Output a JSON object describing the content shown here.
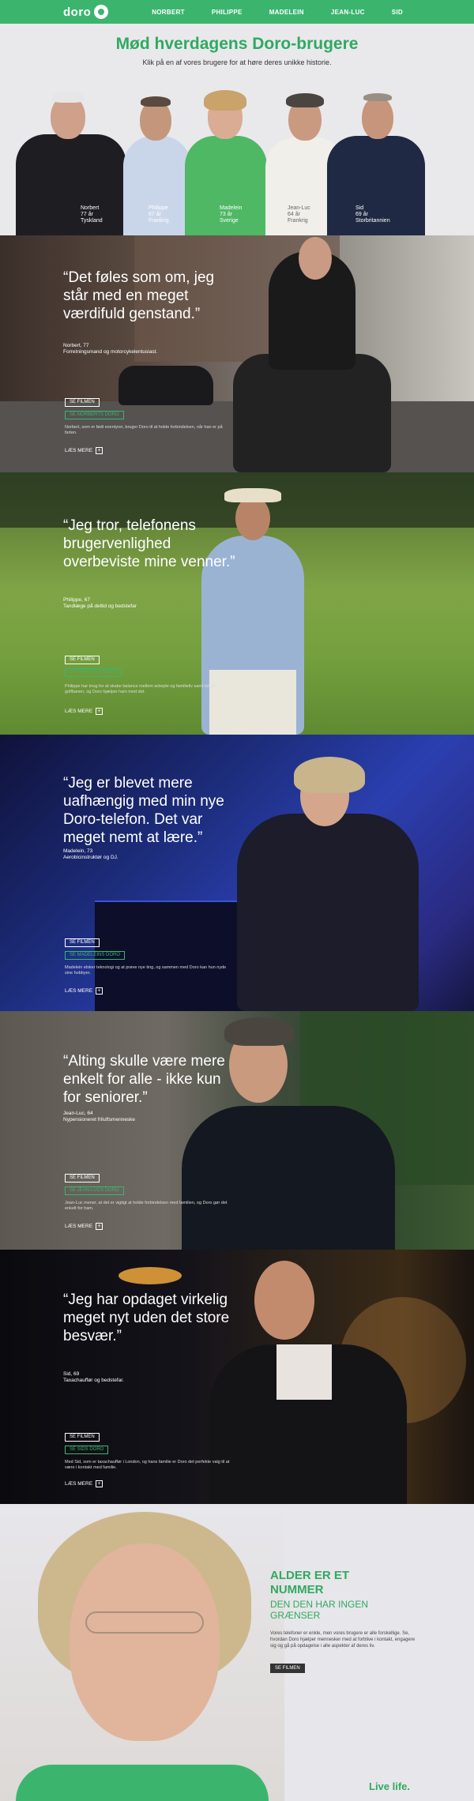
{
  "nav": {
    "logo": "doro",
    "links": [
      "NORBERT",
      "PHILIPPE",
      "MADELEIN",
      "JEAN-LUC",
      "SID"
    ]
  },
  "intro": {
    "title": "Mød hverdagens Doro-brugere",
    "subtitle": "Klik på en af vores brugere for at høre deres unikke historie.",
    "people": [
      {
        "name": "Norbert",
        "age": "77 år",
        "country": "Tyskland"
      },
      {
        "name": "Philippe",
        "age": "67 år",
        "country": "Frankrig"
      },
      {
        "name": "Madelein",
        "age": "73 år",
        "country": "Sverige"
      },
      {
        "name": "Jean-Luc",
        "age": "64 år",
        "country": "Frankrig"
      },
      {
        "name": "Sid",
        "age": "69 år",
        "country": "Storbritannien"
      }
    ]
  },
  "stories": [
    {
      "quote": "“Det føles som om, jeg står med en meget værdifuld genstand.”",
      "name": "Norbert, 77",
      "role": "Forretningsmand og motorcykelentusiast.",
      "film_label": "SE FILMEN",
      "see_label": "SE NORBERTS DORO",
      "desc": "Norbert, som er født eventyrer, bruger Doro til at holde forbindelsen, når han er på farten.",
      "read_more": "LÆS MERE"
    },
    {
      "quote": "“Jeg tror, telefonens brugervenlighed overbeviste mine venner.”",
      "name": "Philippe, 67",
      "role": "Tandlæge på deltid og bedstefar",
      "film_label": "SE FILMEN",
      "see_label": "SE PHILIPPES DORO",
      "desc": "Philippe har brug for at skabe balance mellem arbejde og familieliv samt tid på golfbanen, og Doro hjælper ham med det.",
      "read_more": "LÆS MERE"
    },
    {
      "quote": "“Jeg er blevet mere uafhængig med min nye Doro-telefon. Det var meget nemt at lære.”",
      "name": "Madelein, 73",
      "role": "Aerobicinstruktør og DJ.",
      "film_label": "SE FILMEN",
      "see_label": "SE MADELEINS DORO",
      "desc": "Madelein elsker teknologi og at prøve nye ting, og sammen med Doro kan hun nyde sine hobbyer.",
      "read_more": "LÆS MERE"
    },
    {
      "quote": "“Alting skulle være mere enkelt for alle - ikke kun for seniorer.”",
      "name": "Jean-Luc, 64",
      "role": "Nypensioneret friluftsmenneske",
      "film_label": "SE FILMEN",
      "see_label": "SE JEAN-LUCS DORO",
      "desc": "Jean-Luc mener, at det er vigtigt at holde forbindelsen med familien, og Doro gør det enkelt for ham.",
      "read_more": "LÆS MERE"
    },
    {
      "quote": "“Jeg har opdaget virkelig meget nyt uden det store besvær.”",
      "name": "Sid, 69",
      "role": "Taxachauffør og bedstefar.",
      "film_label": "SE FILMEN",
      "see_label": "SE SIDS DORO",
      "desc": "Med Sid, som er taxachauffør i London, og hans familie er Doro det perfekte valg til at være i kontakt med familie.",
      "read_more": "LÆS MERE"
    }
  ],
  "final": {
    "title_line1": "ALDER ER ET",
    "title_line2": "NUMMER",
    "sub_line1": "DEN DEN HAR INGEN",
    "sub_line2": "GRÆNSER",
    "body": "Vores telefoner er enkle, men vores brugere er alle forskellige. Se, hvordan Doro hjælper mennesker med at forblive i kontakt, engagere sig og gå på opdagelse i alle aspekter af deres liv.",
    "button": "SE FILMEN",
    "tagline": "Live life."
  },
  "colors": {
    "brand_green": "#3bb56e"
  }
}
